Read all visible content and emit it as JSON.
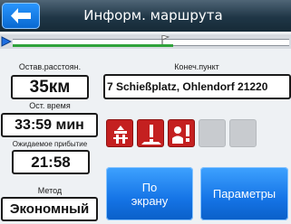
{
  "header": {
    "title": "Информ. маршрута"
  },
  "route": {
    "progress": 0.58
  },
  "fields": {
    "remaining_distance": {
      "label": "Остав.расстоян.",
      "value": "35км"
    },
    "remaining_time": {
      "label": "Ост. время",
      "value": "33:59 мин"
    },
    "arrival": {
      "label": "Ожидаемое прибытие",
      "value": "21:58"
    },
    "method": {
      "label": "Метод",
      "value": "Экономный"
    },
    "destination": {
      "label": "Конеч.пункт",
      "value": "7 Schießplatz, Ohlendorf 21220"
    }
  },
  "warnings": [
    {
      "icon": "toll-road-icon",
      "active": true
    },
    {
      "icon": "road-warning-icon",
      "active": true
    },
    {
      "icon": "driver-warning-icon",
      "active": true
    },
    {
      "icon": "empty-slot",
      "active": false
    },
    {
      "icon": "empty-slot",
      "active": false
    }
  ],
  "buttons": {
    "fit_to_screen": [
      "По",
      "экрану"
    ],
    "parameters": "Параметры"
  },
  "colors": {
    "accent_blue": "#1574e6",
    "warning_red": "#c42020",
    "progress_green": "#2fa23a"
  }
}
